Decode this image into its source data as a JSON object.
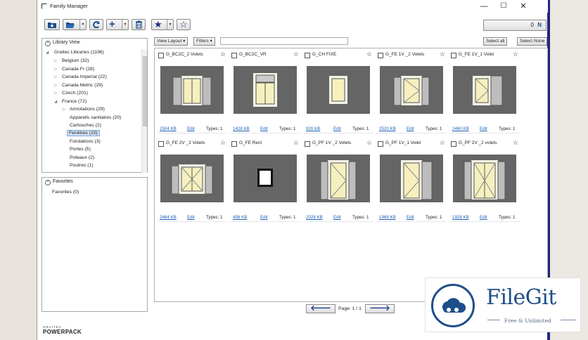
{
  "window": {
    "title": "Family Manager",
    "controls": {
      "minimize": "—",
      "maximize": "☐",
      "close": "✕"
    }
  },
  "toolbar": {
    "counter": "0",
    "select_all": "Select all",
    "select_none": "Select None",
    "view_layout": "View Layout",
    "filters": "Filters",
    "search_value": ""
  },
  "library": {
    "header": "Library View",
    "items": [
      {
        "label": "Graitec Libraries (1196)"
      },
      {
        "label": "Belgium (32)"
      },
      {
        "label": "Canada Fr (28)"
      },
      {
        "label": "Canada Imperial (22)"
      },
      {
        "label": "Canada Metric (29)"
      },
      {
        "label": "Czech (201)"
      },
      {
        "label": "France (72)"
      },
      {
        "label": "Annotations (29)"
      },
      {
        "label": "Appareils sanitaires (20)"
      },
      {
        "label": "Cartouches (2)"
      },
      {
        "label": "Fenêtres (10)"
      },
      {
        "label": "Fondations (3)"
      },
      {
        "label": "Portes (5)"
      },
      {
        "label": "Poteaux (2)"
      },
      {
        "label": "Poutres (1)"
      }
    ]
  },
  "favorites": {
    "header": "Favorites",
    "items": [
      {
        "label": "Favorites (0)"
      }
    ]
  },
  "families": [
    {
      "name": "G_BC2C_2 Volets",
      "size": "2504 KB",
      "edit": "Edit",
      "types": "Types: 1"
    },
    {
      "name": "G_BC2C_VR",
      "size": "1428 KB",
      "edit": "Edit",
      "types": "Types: 1"
    },
    {
      "name": "G_CH FIXE",
      "size": "920 KB",
      "edit": "Edit",
      "types": "Types: 1"
    },
    {
      "name": "G_FE 1V _2 Volets",
      "size": "2520 KB",
      "edit": "Edit",
      "types": "Types: 1"
    },
    {
      "name": "G_FE 1V_1 Volet",
      "size": "2460 KB",
      "edit": "Edit",
      "types": "Types: 1"
    },
    {
      "name": "G_FE 2V _2 Volets",
      "size": "2464 KB",
      "edit": "Edit",
      "types": "Types: 1"
    },
    {
      "name": "G_FE Rect",
      "size": "456 KB",
      "edit": "Edit",
      "types": "Types: 1"
    },
    {
      "name": "G_PF 1V _2 Volets",
      "size": "2028 KB",
      "edit": "Edit",
      "types": "Types: 1"
    },
    {
      "name": "G_PF 1V_1 Volet",
      "size": "1968 KB",
      "edit": "Edit",
      "types": "Types: 1"
    },
    {
      "name": "G_PF 2V _2 volets",
      "size": "1928 KB",
      "edit": "Edit",
      "types": "Types: 1"
    }
  ],
  "pager": {
    "label": "Page: 1 / 1",
    "prev": "🡐",
    "next": "🡒"
  },
  "brand": {
    "top": "GRAITEC",
    "bottom": "POWERPACK"
  },
  "watermark": {
    "name": "FileGit",
    "tagline": "Free & Unlimited"
  },
  "colors": {
    "accent": "#1d4e89",
    "link": "#1a5fb4",
    "thumb_bg": "#656565"
  }
}
